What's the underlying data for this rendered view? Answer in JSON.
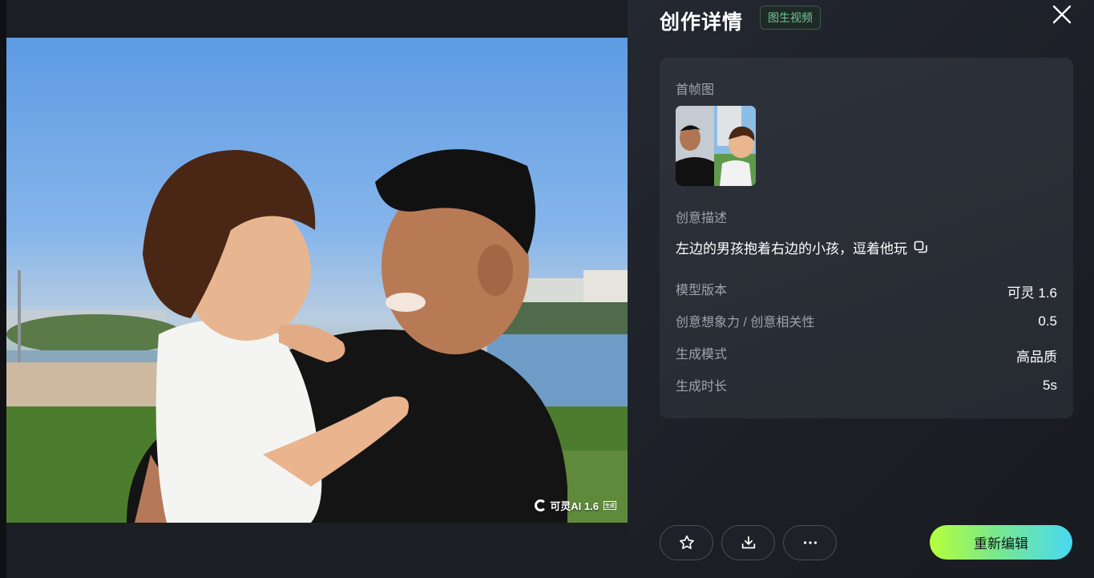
{
  "header": {
    "title": "创作详情",
    "badge": "图生视频"
  },
  "icons": {
    "close": "close-icon",
    "copy": "copy-icon",
    "favorite": "star-icon",
    "download": "download-icon",
    "more": "more-horizontal-icon"
  },
  "media": {
    "watermark_brand": "可灵AI 1.6",
    "watermark_tag": "生成"
  },
  "details": {
    "first_frame_label": "首帧图",
    "prompt_label": "创意描述",
    "prompt_text": "左边的男孩抱着右边的小孩，逗着他玩",
    "rows": [
      {
        "label": "模型版本",
        "value": "可灵 1.6"
      },
      {
        "label": "创意想象力 / 创意相关性",
        "value": "0.5"
      },
      {
        "label": "生成模式",
        "value": "高品质"
      },
      {
        "label": "生成时长",
        "value": "5s"
      }
    ]
  },
  "actions": {
    "re_edit_label": "重新编辑"
  },
  "colors": {
    "accent_gradient_start": "#b7ff3b",
    "accent_gradient_end": "#48d9f2",
    "badge_text": "#71c79a",
    "panel_bg": "#1c1f26",
    "card_bg": "#2a2e35"
  }
}
